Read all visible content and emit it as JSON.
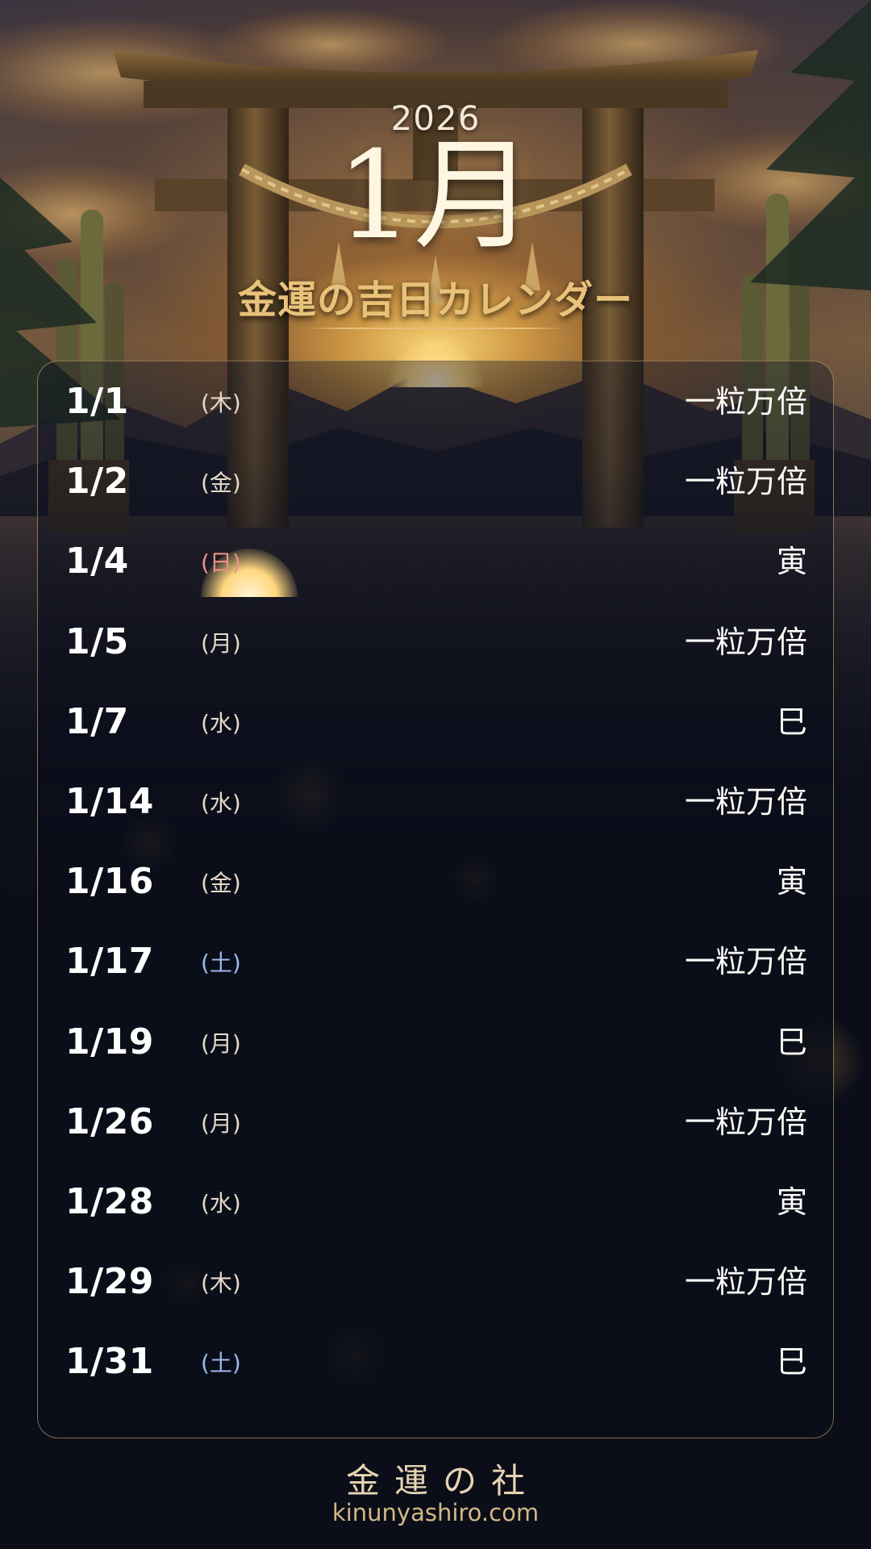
{
  "header": {
    "year": "2026",
    "month": "1月",
    "subtitle": "金運の吉日カレンダー"
  },
  "calendar": {
    "entries": [
      {
        "date": "1/1",
        "weekday": "(木)",
        "label": "一粒万倍",
        "weekday_type": "weekday"
      },
      {
        "date": "1/2",
        "weekday": "(金)",
        "label": "一粒万倍",
        "weekday_type": "weekday"
      },
      {
        "date": "1/4",
        "weekday": "(日)",
        "label": "寅",
        "weekday_type": "sunday"
      },
      {
        "date": "1/5",
        "weekday": "(月)",
        "label": "一粒万倍",
        "weekday_type": "weekday"
      },
      {
        "date": "1/7",
        "weekday": "(水)",
        "label": "巳",
        "weekday_type": "weekday"
      },
      {
        "date": "1/14",
        "weekday": "(水)",
        "label": "一粒万倍",
        "weekday_type": "weekday"
      },
      {
        "date": "1/16",
        "weekday": "(金)",
        "label": "寅",
        "weekday_type": "weekday"
      },
      {
        "date": "1/17",
        "weekday": "(土)",
        "label": "一粒万倍",
        "weekday_type": "saturday"
      },
      {
        "date": "1/19",
        "weekday": "(月)",
        "label": "巳",
        "weekday_type": "weekday"
      },
      {
        "date": "1/26",
        "weekday": "(月)",
        "label": "一粒万倍",
        "weekday_type": "weekday"
      },
      {
        "date": "1/28",
        "weekday": "(水)",
        "label": "寅",
        "weekday_type": "weekday"
      },
      {
        "date": "1/29",
        "weekday": "(木)",
        "label": "一粒万倍",
        "weekday_type": "weekday"
      },
      {
        "date": "1/31",
        "weekday": "(土)",
        "label": "巳",
        "weekday_type": "saturday"
      }
    ]
  },
  "footer": {
    "brand": "金運の社",
    "url": "kinunyashiro.com"
  },
  "colors": {
    "gold_accent": "#e9c27a",
    "sunday": "#f0908a",
    "saturday": "#9fb8f0",
    "panel_border": "#c8a56e",
    "background": "#0b0e19"
  }
}
